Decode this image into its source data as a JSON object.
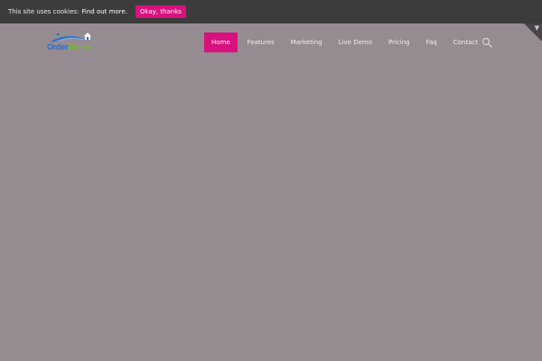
{
  "cookie_bar": {
    "text": "This site uses cookies:",
    "link_label": "Find out more.",
    "accept_label": "Okay, thanks"
  },
  "logo": {
    "part1": "Order",
    "part2": "Sense"
  },
  "nav": {
    "items": [
      {
        "label": "Home",
        "active": true
      },
      {
        "label": "Features"
      },
      {
        "label": "Marketing"
      },
      {
        "label": "Live Demo"
      },
      {
        "label": "Pricing"
      },
      {
        "label": "Faq"
      },
      {
        "label": "Contact"
      }
    ]
  },
  "colors": {
    "accent": "#d9117e",
    "page_bg": "#958b90",
    "cookie_bg": "#3c3c3c",
    "logo_blue": "#1f6fd6",
    "logo_green": "#74b832"
  },
  "icons": {
    "search": "search-icon",
    "toggle": "chevron-down-icon"
  }
}
